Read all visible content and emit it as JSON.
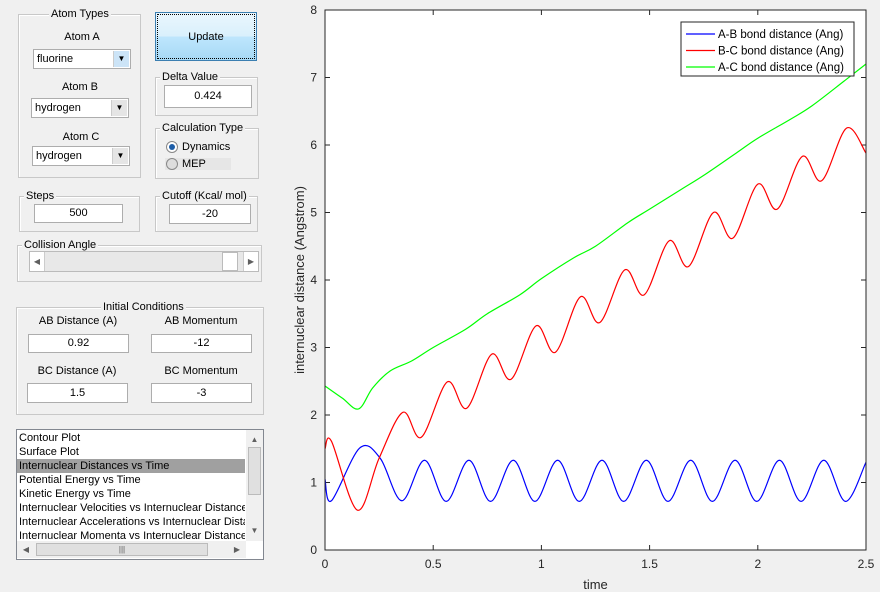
{
  "atom_types": {
    "title": "Atom Types",
    "atom_a_label": "Atom A",
    "atom_a_value": "fluorine",
    "atom_b_label": "Atom B",
    "atom_b_value": "hydrogen",
    "atom_c_label": "Atom C",
    "atom_c_value": "hydrogen"
  },
  "update_label": "Update",
  "delta": {
    "title": "Delta Value",
    "value": "0.424"
  },
  "calc_type": {
    "title": "Calculation Type",
    "options": [
      "Dynamics",
      "MEP"
    ],
    "selected": "Dynamics"
  },
  "steps": {
    "title": "Steps",
    "value": "500"
  },
  "cutoff": {
    "title": "Cutoff (Kcal/ mol)",
    "value": "-20"
  },
  "collision": {
    "title": "Collision Angle",
    "slider_fraction": 0.97
  },
  "initial": {
    "title": "Initial Conditions",
    "ab_dist_label": "AB Distance (A)",
    "ab_dist": "0.92",
    "ab_mom_label": "AB Momentum",
    "ab_mom": "-12",
    "bc_dist_label": "BC Distance (A)",
    "bc_dist": "1.5",
    "bc_mom_label": "BC Momentum",
    "bc_mom": "-3"
  },
  "plot_list": {
    "items": [
      "Contour Plot",
      "Surface Plot",
      "Internuclear Distances vs Time",
      "Potential Energy vs Time",
      "Kinetic Energy vs Time",
      "Internuclear Velocities vs Internuclear Distances",
      "Internuclear Accelerations vs Internuclear Distances",
      "Internuclear Momenta vs Internuclear Distances"
    ],
    "selected_index": 2
  },
  "chart_data": {
    "type": "line",
    "xlabel": "time",
    "ylabel": "internuclear distance (Angstrom)",
    "xlim": [
      0,
      2.5
    ],
    "ylim": [
      0,
      8
    ],
    "xticks": [
      "0",
      "0.5",
      "1",
      "1.5",
      "2",
      "2.5"
    ],
    "yticks": [
      "0",
      "1",
      "2",
      "3",
      "4",
      "5",
      "6",
      "7",
      "8"
    ],
    "grid": false,
    "legend_position": "top-right",
    "series": [
      {
        "name": "A-B bond distance (Ang)",
        "color": "#0000ff",
        "points": [
          [
            0,
            1.05
          ],
          [
            0.03,
            0.73
          ],
          [
            0.16,
            1.51
          ],
          [
            0.255,
            1.36
          ],
          [
            0.355,
            0.73
          ],
          [
            0.46,
            1.33
          ],
          [
            0.56,
            0.72
          ],
          [
            0.665,
            1.33
          ],
          [
            0.765,
            0.72
          ],
          [
            0.87,
            1.33
          ],
          [
            0.97,
            0.72
          ],
          [
            1.075,
            1.33
          ],
          [
            1.175,
            0.72
          ],
          [
            1.28,
            1.33
          ],
          [
            1.38,
            0.72
          ],
          [
            1.485,
            1.33
          ],
          [
            1.585,
            0.72
          ],
          [
            1.69,
            1.33
          ],
          [
            1.79,
            0.72
          ],
          [
            1.895,
            1.33
          ],
          [
            1.995,
            0.72
          ],
          [
            2.1,
            1.33
          ],
          [
            2.2,
            0.72
          ],
          [
            2.305,
            1.33
          ],
          [
            2.405,
            0.72
          ],
          [
            2.5,
            1.3
          ]
        ]
      },
      {
        "name": "B-C bond distance (Ang)",
        "color": "#ff0000",
        "points": [
          [
            0,
            1.5
          ],
          [
            0.03,
            1.61
          ],
          [
            0.15,
            0.59
          ],
          [
            0.25,
            1.36
          ],
          [
            0.36,
            2.04
          ],
          [
            0.445,
            1.67
          ],
          [
            0.565,
            2.49
          ],
          [
            0.655,
            2.1
          ],
          [
            0.77,
            2.9
          ],
          [
            0.86,
            2.53
          ],
          [
            0.975,
            3.32
          ],
          [
            1.065,
            2.93
          ],
          [
            1.18,
            3.75
          ],
          [
            1.27,
            3.37
          ],
          [
            1.385,
            4.15
          ],
          [
            1.475,
            3.78
          ],
          [
            1.59,
            4.58
          ],
          [
            1.68,
            4.2
          ],
          [
            1.795,
            5.0
          ],
          [
            1.885,
            4.62
          ],
          [
            2.0,
            5.42
          ],
          [
            2.09,
            5.05
          ],
          [
            2.205,
            5.83
          ],
          [
            2.295,
            5.47
          ],
          [
            2.41,
            6.25
          ],
          [
            2.5,
            5.88
          ]
        ]
      },
      {
        "name": "A-C bond distance (Ang)",
        "color": "#00ff00",
        "points": [
          [
            0,
            2.43
          ],
          [
            0.08,
            2.25
          ],
          [
            0.155,
            2.09
          ],
          [
            0.22,
            2.4
          ],
          [
            0.3,
            2.65
          ],
          [
            0.4,
            2.8
          ],
          [
            0.5,
            3.0
          ],
          [
            0.65,
            3.27
          ],
          [
            0.75,
            3.5
          ],
          [
            0.9,
            3.78
          ],
          [
            1.0,
            4.02
          ],
          [
            1.15,
            4.33
          ],
          [
            1.25,
            4.5
          ],
          [
            1.4,
            4.85
          ],
          [
            1.5,
            5.05
          ],
          [
            1.65,
            5.35
          ],
          [
            1.75,
            5.55
          ],
          [
            1.9,
            5.88
          ],
          [
            2.0,
            6.1
          ],
          [
            2.15,
            6.38
          ],
          [
            2.25,
            6.58
          ],
          [
            2.4,
            6.95
          ],
          [
            2.5,
            7.2
          ]
        ]
      }
    ]
  }
}
